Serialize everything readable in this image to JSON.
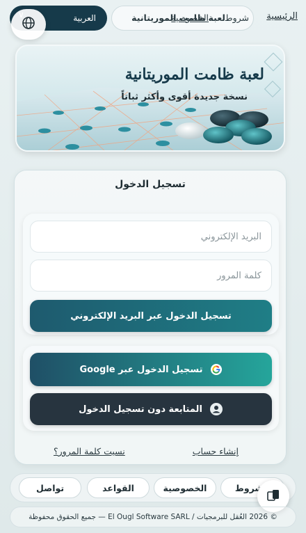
{
  "topbar": {
    "language_label": "العربية",
    "home_link": "الرئيسية",
    "nav_overlap_texts": [
      "شروط",
      "لعبة ظامت الموريتانية",
      "الخصوصية"
    ]
  },
  "hero": {
    "title": "لعبة ظامت الموريتانية",
    "subtitle": "نسخة جديدة أقوى وأكثر ثباتاً"
  },
  "login": {
    "title": "تسجيل الدخول",
    "email_placeholder": "البريد الإلكتروني",
    "password_placeholder": "كلمة المرور",
    "email_button": "تسجيل الدخول عبر البريد الإلكتروني",
    "google_button": "تسجيل الدخول عبر Google",
    "guest_button": "المتابعة دون تسجيل الدخول",
    "create_account": "إنشاء حساب",
    "forgot_password": "نسيت كلمة المرور؟"
  },
  "footer": {
    "links": [
      "الشروط",
      "الخصوصية",
      "القواعد",
      "تواصل"
    ],
    "copyright": "© 2026 العُقل للبرمجيات / El Ougl Software SARL — جميع الحقوق محفوظة"
  },
  "colors": {
    "primary_dark": "#163a4a",
    "teal_accent": "#1f7e86",
    "guest_button": "#27343f"
  },
  "icons": [
    "globe-icon",
    "chevron-down-icon",
    "google-icon",
    "user-icon",
    "screen-toggle-icon"
  ]
}
